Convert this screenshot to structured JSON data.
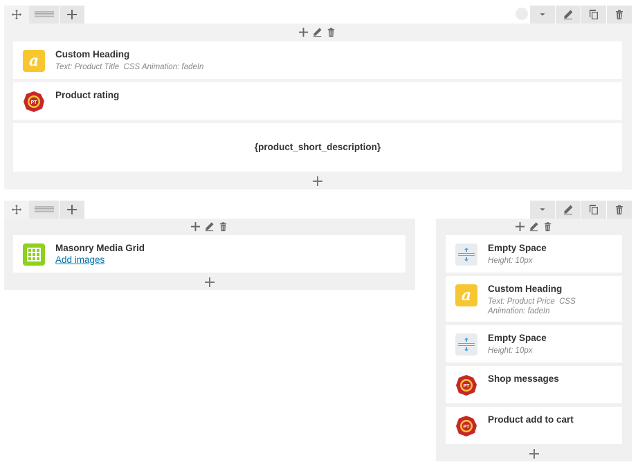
{
  "row1": {
    "elements": {
      "custom_heading": {
        "title": "Custom Heading",
        "subtitle": "Text: Product Title  CSS Animation: fadeIn"
      },
      "product_rating": {
        "title": "Product rating"
      },
      "short_description": {
        "text": "{product_short_description}"
      }
    }
  },
  "row2": {
    "left": {
      "elements": {
        "masonry": {
          "title": "Masonry Media Grid",
          "link": "Add images"
        }
      }
    },
    "right": {
      "elements": {
        "empty_space_1": {
          "title": "Empty Space",
          "subtitle": "Height: 10px"
        },
        "custom_heading": {
          "title": "Custom Heading",
          "subtitle_line1": "Text: Product Price  CSS",
          "subtitle_line2": "Animation: fadeIn"
        },
        "empty_space_2": {
          "title": "Empty Space",
          "subtitle": "Height: 10px"
        },
        "shop_messages": {
          "title": "Shop messages"
        },
        "add_to_cart": {
          "title": "Product add to cart"
        }
      }
    }
  },
  "icons": {
    "heading": "a",
    "plugin": "PT"
  },
  "colors": {
    "heading_icon": "#f8c631",
    "grid_icon": "#8cd11c",
    "plugin_icon": "#c62828",
    "link": "#0073aa"
  }
}
